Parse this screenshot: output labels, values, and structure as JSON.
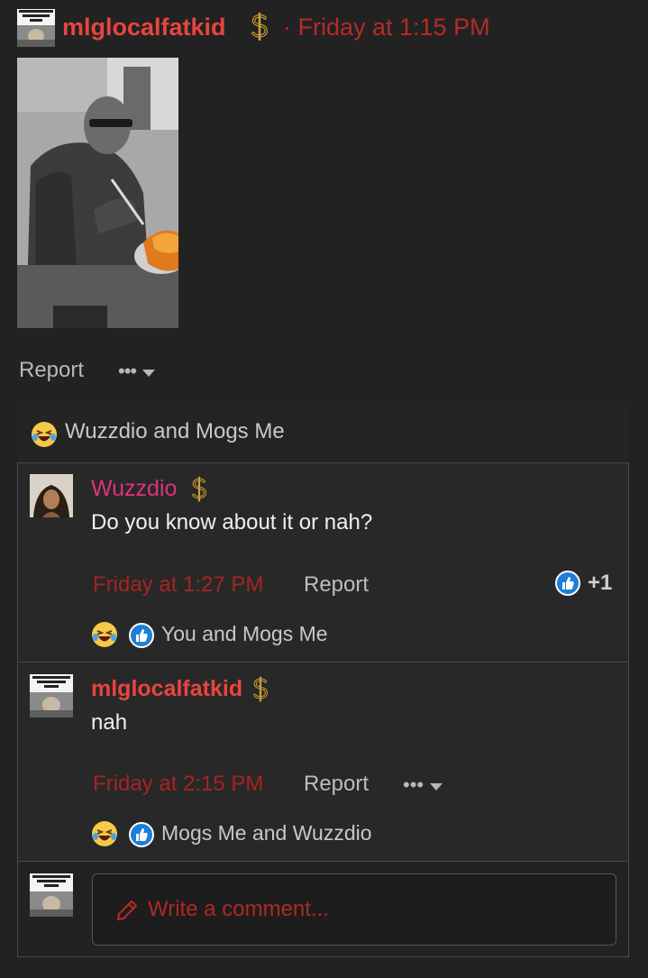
{
  "post": {
    "author": "mlglocalfatkid",
    "time": "· Friday at 1:15 PM",
    "avatar_caption": "How bro looks at you after he says hes Aryan",
    "actions": {
      "report": "Report",
      "more": "•••"
    }
  },
  "reactions_summary": {
    "text": "Wuzzdio and Mogs Me"
  },
  "comments": [
    {
      "author": "Wuzzdio",
      "text": "Do you know about it or nah?",
      "time": "Friday at 1:27 PM",
      "report": "Report",
      "like_count": "+1",
      "reactors": "You and Mogs Me"
    },
    {
      "author": "mlglocalfatkid",
      "text": "nah",
      "time": "Friday at 2:15 PM",
      "report": "Report",
      "more": "•••",
      "reactors": "Mogs Me and Wuzzdio",
      "avatar_caption": "How bro looks at you after he says hes Aryan"
    }
  ],
  "composer": {
    "placeholder": "Write a comment...",
    "avatar_caption": "How bro looks at you after he says hes Aryan"
  },
  "colors": {
    "background": "#222222",
    "username_red": "#e8443f",
    "username_pink": "#e0327a",
    "time_red": "#a52522",
    "like_blue": "#1e7ed8",
    "dollar_gold": "#c9a13a"
  }
}
